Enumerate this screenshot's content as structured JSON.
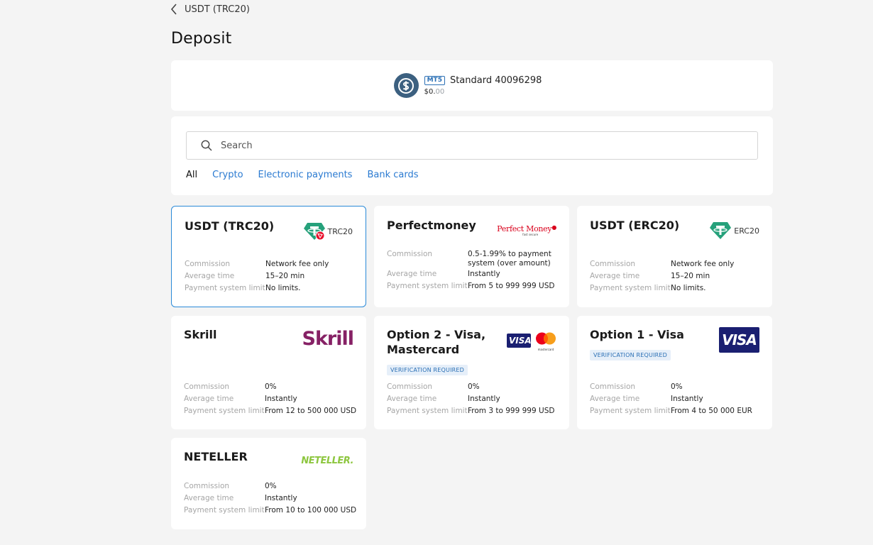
{
  "header": {
    "back_label": "USDT (TRC20)",
    "title": "Deposit"
  },
  "account": {
    "platform": "MT5",
    "name": "Standard 40096298",
    "balance_main": "$0.",
    "balance_cents": "00"
  },
  "search": {
    "placeholder": "Search"
  },
  "tabs": [
    "All",
    "Crypto",
    "Electronic payments",
    "Bank cards"
  ],
  "labels": {
    "commission": "Commission",
    "average_time": "Average time",
    "limit": "Payment system limit"
  },
  "methods": [
    {
      "title": "USDT (TRC20)",
      "logo_text": "TRC20",
      "logo": "tether-trc20-icon",
      "commission": "Network fee only",
      "time": "15–20 min",
      "limit": "No limits."
    },
    {
      "title": "Perfectmoney",
      "logo_text": "Perfect Money",
      "logo_sub": "fast secure",
      "logo": "perfectmoney-logo",
      "commission": "0.5-1.99% to payment system (over amount)",
      "time": "Instantly",
      "limit": "From 5 to 999 999 USD"
    },
    {
      "title": "USDT (ERC20)",
      "logo_text": "ERC20",
      "logo": "tether-erc20-icon",
      "commission": "Network fee only",
      "time": "15–20 min",
      "limit": "No limits."
    },
    {
      "title": "Skrill",
      "logo_text": "Skrill",
      "logo": "skrill-logo",
      "commission": "0%",
      "time": "Instantly",
      "limit": "From 12 to 500 000 USD"
    },
    {
      "title": "Option 2 - Visa, Mastercard",
      "logo_text": "VISA",
      "logo_sub": "mastercard",
      "logo": "visa-mastercard-logo",
      "badge": "VERIFICATION REQUIRED",
      "commission": "0%",
      "time": "Instantly",
      "limit": "From 3 to 999 999 USD"
    },
    {
      "title": "Option 1 - Visa",
      "logo_text": "VISA",
      "logo": "visa-logo",
      "badge": "VERIFICATION REQUIRED",
      "commission": "0%",
      "time": "Instantly",
      "limit": "From 4 to 50 000 EUR"
    },
    {
      "title": "NETELLER",
      "logo_text": "NETELLER.",
      "logo": "neteller-logo",
      "commission": "0%",
      "time": "Instantly",
      "limit": "From 10 to 100 000 USD"
    }
  ],
  "colors": {
    "accent": "#2a7ad1",
    "tether": "#26a17b",
    "tron": "#e8112d",
    "skrill": "#862165",
    "visa": "#1a1f71",
    "neteller": "#8dc63f",
    "perfectmoney": "#d9001b"
  }
}
